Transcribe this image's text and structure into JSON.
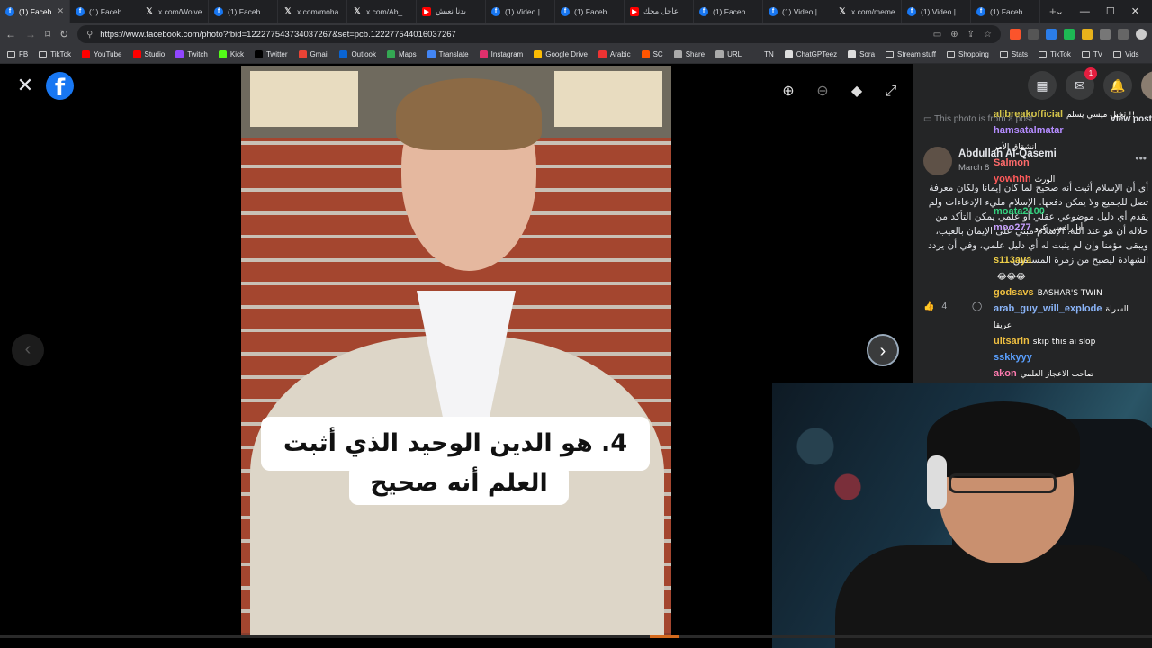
{
  "tabs": [
    {
      "label": "(1) Faceb",
      "icon": "facebook-icon",
      "active": true
    },
    {
      "label": "(1) Facebook",
      "icon": "facebook-icon"
    },
    {
      "label": "x.com/Wolve",
      "icon": "x-icon"
    },
    {
      "label": "(1) Facebook",
      "icon": "facebook-icon"
    },
    {
      "label": "x.com/moha",
      "icon": "x-icon"
    },
    {
      "label": "x.com/Ab_ou",
      "icon": "x-icon"
    },
    {
      "label": "بدنا نعيش",
      "icon": "youtube-icon"
    },
    {
      "label": "(1) Video | Fa",
      "icon": "facebook-icon"
    },
    {
      "label": "(1) Facebook",
      "icon": "facebook-icon"
    },
    {
      "label": "عاجل محك",
      "icon": "youtube-icon"
    },
    {
      "label": "(1) Facebook",
      "icon": "facebook-icon"
    },
    {
      "label": "(1) Video | Fa",
      "icon": "facebook-icon"
    },
    {
      "label": "x.com/meme",
      "icon": "x-icon"
    },
    {
      "label": "(1) Video | Fa",
      "icon": "facebook-icon"
    },
    {
      "label": "(1) Facebook",
      "icon": "facebook-icon"
    }
  ],
  "address": {
    "url": "https://www.facebook.com/photo?fbid=122277543734037267&set=pcb.122277544016037267"
  },
  "bookmarks": [
    {
      "label": "FB",
      "icon": "folder-icon"
    },
    {
      "label": "TikTok",
      "icon": "folder-icon"
    },
    {
      "label": "YouTube",
      "icon": "youtube-icon",
      "color": "#ff0000"
    },
    {
      "label": "Studio",
      "icon": "youtube-studio-icon",
      "color": "#ff0000"
    },
    {
      "label": "Twitch",
      "icon": "twitch-icon",
      "color": "#9146ff"
    },
    {
      "label": "Kick",
      "icon": "kick-icon",
      "color": "#53fc18"
    },
    {
      "label": "Twitter",
      "icon": "x-icon",
      "color": "#000000"
    },
    {
      "label": "Gmail",
      "icon": "gmail-icon",
      "color": "#ea4335"
    },
    {
      "label": "Outlook",
      "icon": "outlook-icon",
      "color": "#0a64d2"
    },
    {
      "label": "Maps",
      "icon": "maps-icon",
      "color": "#34a853"
    },
    {
      "label": "Translate",
      "icon": "translate-icon",
      "color": "#4285f4"
    },
    {
      "label": "Instagram",
      "icon": "instagram-icon",
      "color": "#e1306c"
    },
    {
      "label": "Google Drive",
      "icon": "drive-icon",
      "color": "#fbbc04"
    },
    {
      "label": "Arabic",
      "icon": "arabic-icon",
      "color": "#e33"
    },
    {
      "label": "SC",
      "icon": "soundcloud-icon",
      "color": "#ff5500"
    },
    {
      "label": "Share",
      "icon": "share-icon",
      "color": "#aaaaaa"
    },
    {
      "label": "URL",
      "icon": "url-icon",
      "color": "#aaaaaa"
    },
    {
      "label": "TN",
      "icon": "tn-icon",
      "color": "#35363a"
    },
    {
      "label": "ChatGPTeez",
      "icon": "chatgpt-icon",
      "color": "#dddddd"
    },
    {
      "label": "Sora",
      "icon": "sora-icon",
      "color": "#dddddd"
    },
    {
      "label": "Stream stuff",
      "icon": "folder-icon"
    },
    {
      "label": "Shopping",
      "icon": "folder-icon"
    },
    {
      "label": "Stats",
      "icon": "folder-icon"
    },
    {
      "label": "TikTok",
      "icon": "folder-icon"
    },
    {
      "label": "TV",
      "icon": "folder-icon"
    },
    {
      "label": "Vids",
      "icon": "folder-icon"
    }
  ],
  "photo": {
    "caption_line1": "4. هو الدين الوحيد الذي أثبت",
    "caption_line2": "العلم أنه صحيح"
  },
  "side": {
    "notice": "This photo is from a post.",
    "view_post": "View post",
    "author": "Abdullah Al-Qasemi",
    "date": "March 8",
    "body": "أي أن الإسلام أثبت أنه صحيح لما كان إيمانا ولكان معرفة تصل للجميع ولا يمكن دفعها. الإسلام مليء الإدعاءات ولم يقدم أي دليل موضوعي عقلي أو علمي يمكن التأكد من خلاله أن هو عند الله. الإسلام مبني على الإيمان بالغيب، ويبقى مؤمنا وإن لم يثبت له أي دليل علمي، وفي أن يردد الشهادة ليصبح من زمرة المسلمين.",
    "like_count": "4",
    "messenger_badge": "1"
  },
  "chat": [
    {
      "user": "alibreakofficial",
      "text": "تخيل ميسي يسلم !!",
      "color": "#d4c44a"
    },
    {
      "user": "hamsatalmatar",
      "text": "",
      "color": "#b48cff"
    },
    {
      "user": "",
      "text": "انشقاق الأمر",
      "color": "#ffffff"
    },
    {
      "user": "Salmon",
      "text": "",
      "color": "#ff6b6b"
    },
    {
      "user": "yowhhh",
      "text": "الورث",
      "color": "#ff5a5a"
    },
    {
      "user": "",
      "text": "",
      "color": "#ffffff"
    },
    {
      "user": "moata2100",
      "text": "",
      "color": "#35d07f"
    },
    {
      "user": "moo277",
      "text": "أنا رافضي كرو",
      "color": "#c8a0ff"
    },
    {
      "user": "",
      "text": "",
      "color": "#ffffff"
    },
    {
      "user": "s113aya",
      "text": "",
      "color": "#f0d048"
    },
    {
      "user": "",
      "text": "😂😂😂",
      "color": "#ffffff"
    },
    {
      "user": "godsavs",
      "text": "BASHAR'S TWIN",
      "color": "#f0c040"
    },
    {
      "user": "arab_guy_will_explode",
      "text": "السراة",
      "color": "#8ab4f8"
    },
    {
      "user": "",
      "text": "عريقا",
      "color": "#ffffff"
    },
    {
      "user": "ultsarin",
      "text": "skip this ai slop",
      "color": "#f0c040"
    },
    {
      "user": "sskkyyy",
      "text": "",
      "color": "#5aa0ff"
    },
    {
      "user": "akon",
      "text": "صاحب الاعجاز العلمي",
      "color": "#ff7bb0"
    }
  ]
}
